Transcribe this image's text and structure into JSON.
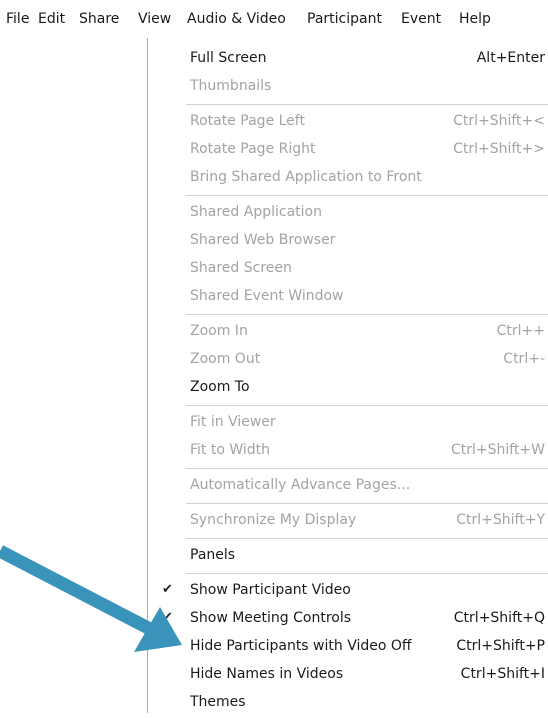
{
  "menubar": [
    {
      "label": "File"
    },
    {
      "label": "Edit"
    },
    {
      "label": "Share"
    },
    {
      "label": "View"
    },
    {
      "label": "Audio & Video"
    },
    {
      "label": "Participant"
    },
    {
      "label": "Event"
    },
    {
      "label": "Help"
    }
  ],
  "view_menu": {
    "items": [
      {
        "label": "Full Screen",
        "shortcut": "Alt+Enter",
        "enabled": true,
        "checked": false
      },
      {
        "label": "Thumbnails",
        "shortcut": "",
        "enabled": false,
        "checked": false
      },
      {
        "label": "Rotate Page Left",
        "shortcut": "Ctrl+Shift+<",
        "enabled": false,
        "checked": false
      },
      {
        "label": "Rotate Page Right",
        "shortcut": "Ctrl+Shift+>",
        "enabled": false,
        "checked": false
      },
      {
        "label": "Bring Shared Application to Front",
        "shortcut": "",
        "enabled": false,
        "checked": false
      },
      {
        "label": "Shared Application",
        "shortcut": "",
        "enabled": false,
        "checked": false
      },
      {
        "label": "Shared Web Browser",
        "shortcut": "",
        "enabled": false,
        "checked": false
      },
      {
        "label": "Shared Screen",
        "shortcut": "",
        "enabled": false,
        "checked": false
      },
      {
        "label": "Shared Event Window",
        "shortcut": "",
        "enabled": false,
        "checked": false
      },
      {
        "label": "Zoom In",
        "shortcut": "Ctrl++",
        "enabled": false,
        "checked": false
      },
      {
        "label": "Zoom Out",
        "shortcut": "Ctrl+-",
        "enabled": false,
        "checked": false
      },
      {
        "label": "Zoom To",
        "shortcut": "",
        "enabled": true,
        "checked": false
      },
      {
        "label": "Fit in Viewer",
        "shortcut": "",
        "enabled": false,
        "checked": false
      },
      {
        "label": "Fit to Width",
        "shortcut": "Ctrl+Shift+W",
        "enabled": false,
        "checked": false
      },
      {
        "label": "Automatically Advance Pages...",
        "shortcut": "",
        "enabled": false,
        "checked": false
      },
      {
        "label": "Synchronize My Display",
        "shortcut": "Ctrl+Shift+Y",
        "enabled": false,
        "checked": false
      },
      {
        "label": "Panels",
        "shortcut": "",
        "enabled": true,
        "checked": false
      },
      {
        "label": "Show Participant Video",
        "shortcut": "",
        "enabled": true,
        "checked": true
      },
      {
        "label": "Show Meeting Controls",
        "shortcut": "Ctrl+Shift+Q",
        "enabled": true,
        "checked": true
      },
      {
        "label": "Hide Participants with Video Off",
        "shortcut": "Ctrl+Shift+P",
        "enabled": true,
        "checked": false
      },
      {
        "label": "Hide Names in Videos",
        "shortcut": "Ctrl+Shift+I",
        "enabled": true,
        "checked": false
      },
      {
        "label": "Themes",
        "shortcut": "",
        "enabled": true,
        "checked": false
      }
    ],
    "check_glyph": "✔"
  },
  "annotation": {
    "arrow_color": "#3a93ba"
  }
}
